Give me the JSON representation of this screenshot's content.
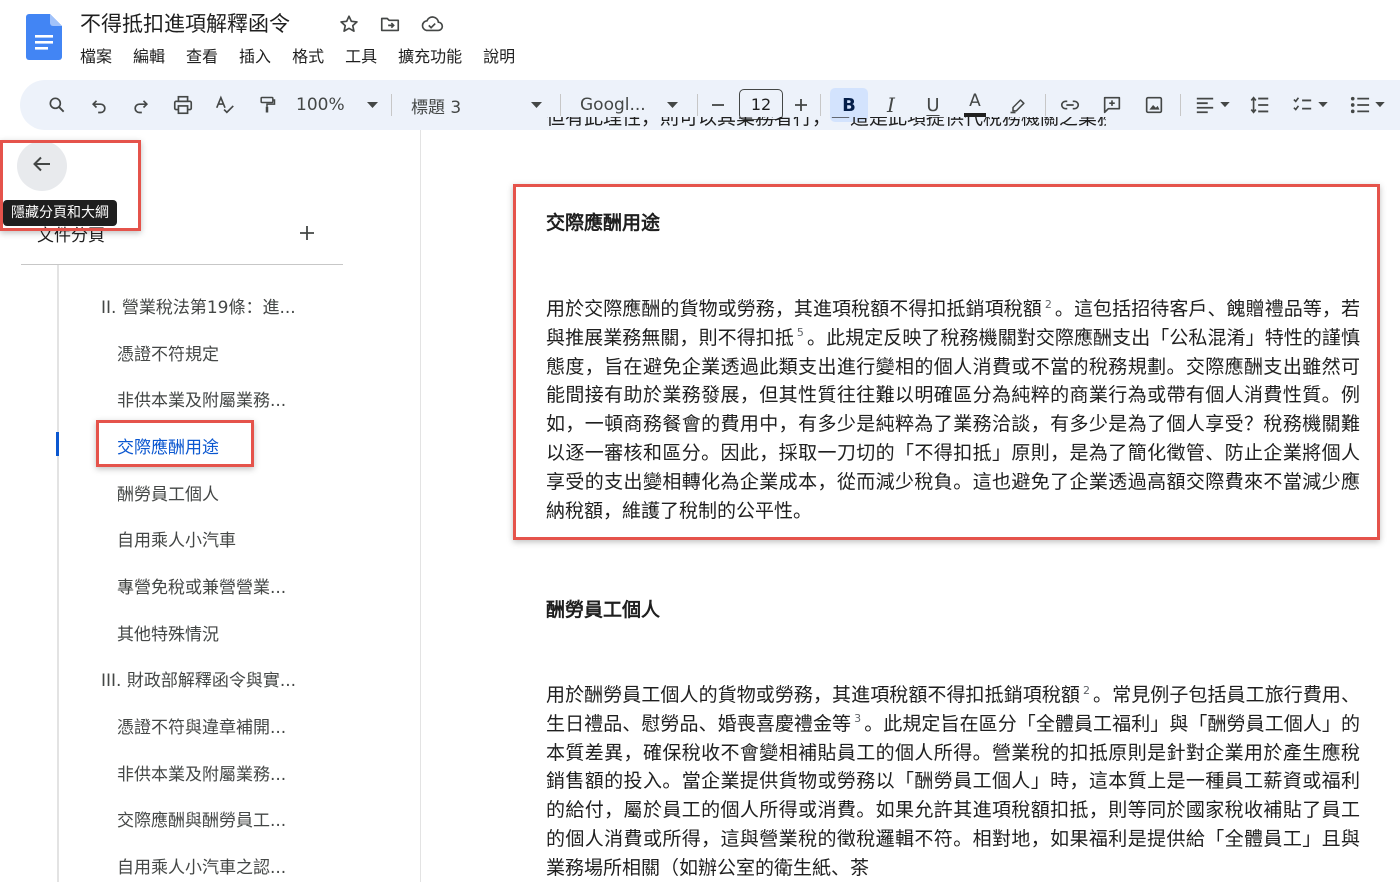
{
  "doc": {
    "title": "不得抵扣進項解釋函令",
    "menu": [
      "檔案",
      "編輯",
      "查看",
      "插入",
      "格式",
      "工具",
      "擴充功能",
      "說明"
    ]
  },
  "toolbar": {
    "zoom": "100%",
    "style": "標題 3",
    "font": "Googl...",
    "font_size": "12",
    "bold": "B",
    "italic": "I",
    "underline": "U",
    "text_color": "A"
  },
  "sidebar": {
    "tooltip": "隱藏分頁和大綱",
    "tabs_label": "文件分頁",
    "outline": [
      "II. 營業稅法第19條：進...",
      "憑證不符規定",
      "非供本業及附屬業務...",
      "交際應酬用途",
      "酬勞員工個人",
      "自用乘人小汽車",
      "專營免稅或兼營營業...",
      "其他特殊情況",
      "III. 財政部解釋函令與實...",
      "憑證不符與違章補開...",
      "非供本業及附屬業務...",
      "交際應酬與酬勞員工...",
      "自用乘人小汽車之認..."
    ]
  },
  "content": {
    "cut_line": "但有此理性，則可以其業務者行，一這是此項提供代稅務機關之業務外行有關之其他",
    "section1": {
      "heading": "交際應酬用途",
      "p_a": "用於交際應酬的貨物或勞務，其進項稅額不得扣抵銷項稅額",
      "sup_a": "2",
      "p_b": "。這包括招待客戶、餽贈禮品等，若與推展業務無關，則不得扣抵",
      "sup_b": "5",
      "p_c": "。此規定反映了稅務機關對交際應酬支出「公私混淆」特性的謹慎態度，旨在避免企業透過此類支出進行變相的個人消費或不當的稅務規劃。交際應酬支出雖然可能間接有助於業務發展，但其性質往往難以明確區分為純粹的商業行為或帶有個人消費性質。例如，一頓商務餐會的費用中，有多少是純粹為了業務洽談，有多少是為了個人享受？稅務機關難以逐一審核和區分。因此，採取一刀切的「不得扣抵」原則，是為了簡化徵管、防止企業將個人享受的支出變相轉化為企業成本，從而減少稅負。這也避免了企業透過高額交際費來不當減少應納稅額，維護了稅制的公平性。"
    },
    "section2": {
      "heading": "酬勞員工個人",
      "p_a": "用於酬勞員工個人的貨物或勞務，其進項稅額不得扣抵銷項稅額",
      "sup_a": "2",
      "p_b": "。常見例子包括員工旅行費用、生日禮品、慰勞品、婚喪喜慶禮金等",
      "sup_b": "3",
      "p_c": "。此規定旨在區分「全體員工福利」與「酬勞員工個人」的本質差異，確保稅收不會變相補貼員工的個人所得。營業稅的扣抵原則是針對企業用於產生應稅銷售額的投入。當企業提供貨物或勞務以「酬勞員工個人」時，這本質上是一種員工薪資或福利的給付，屬於員工的個人所得或消費。如果允許其進項稅額扣抵，則等同於國家稅收補貼了員工的個人消費或所得，這與營業稅的徵稅邏輯不符。相對地，如果福利是提供給「全體員工」且與業務場所相關（如辦公室的衛生紙、茶"
    }
  },
  "colors": {
    "accent": "#0b57d0",
    "highlight_box": "#e5534b",
    "toolbar_bg": "#edf2fa",
    "bold_active": "#d3e3fd"
  },
  "icons": [
    "docs-logo-icon",
    "star-icon",
    "move-folder-icon",
    "cloud-saved-icon",
    "search-icon",
    "undo-icon",
    "redo-icon",
    "print-icon",
    "spellcheck-icon",
    "paint-format-icon",
    "highlighter-icon",
    "link-icon",
    "add-comment-icon",
    "insert-image-icon",
    "align-icon",
    "line-spacing-icon",
    "checklist-icon",
    "bulleted-list-icon",
    "back-arrow-icon",
    "add-icon"
  ]
}
